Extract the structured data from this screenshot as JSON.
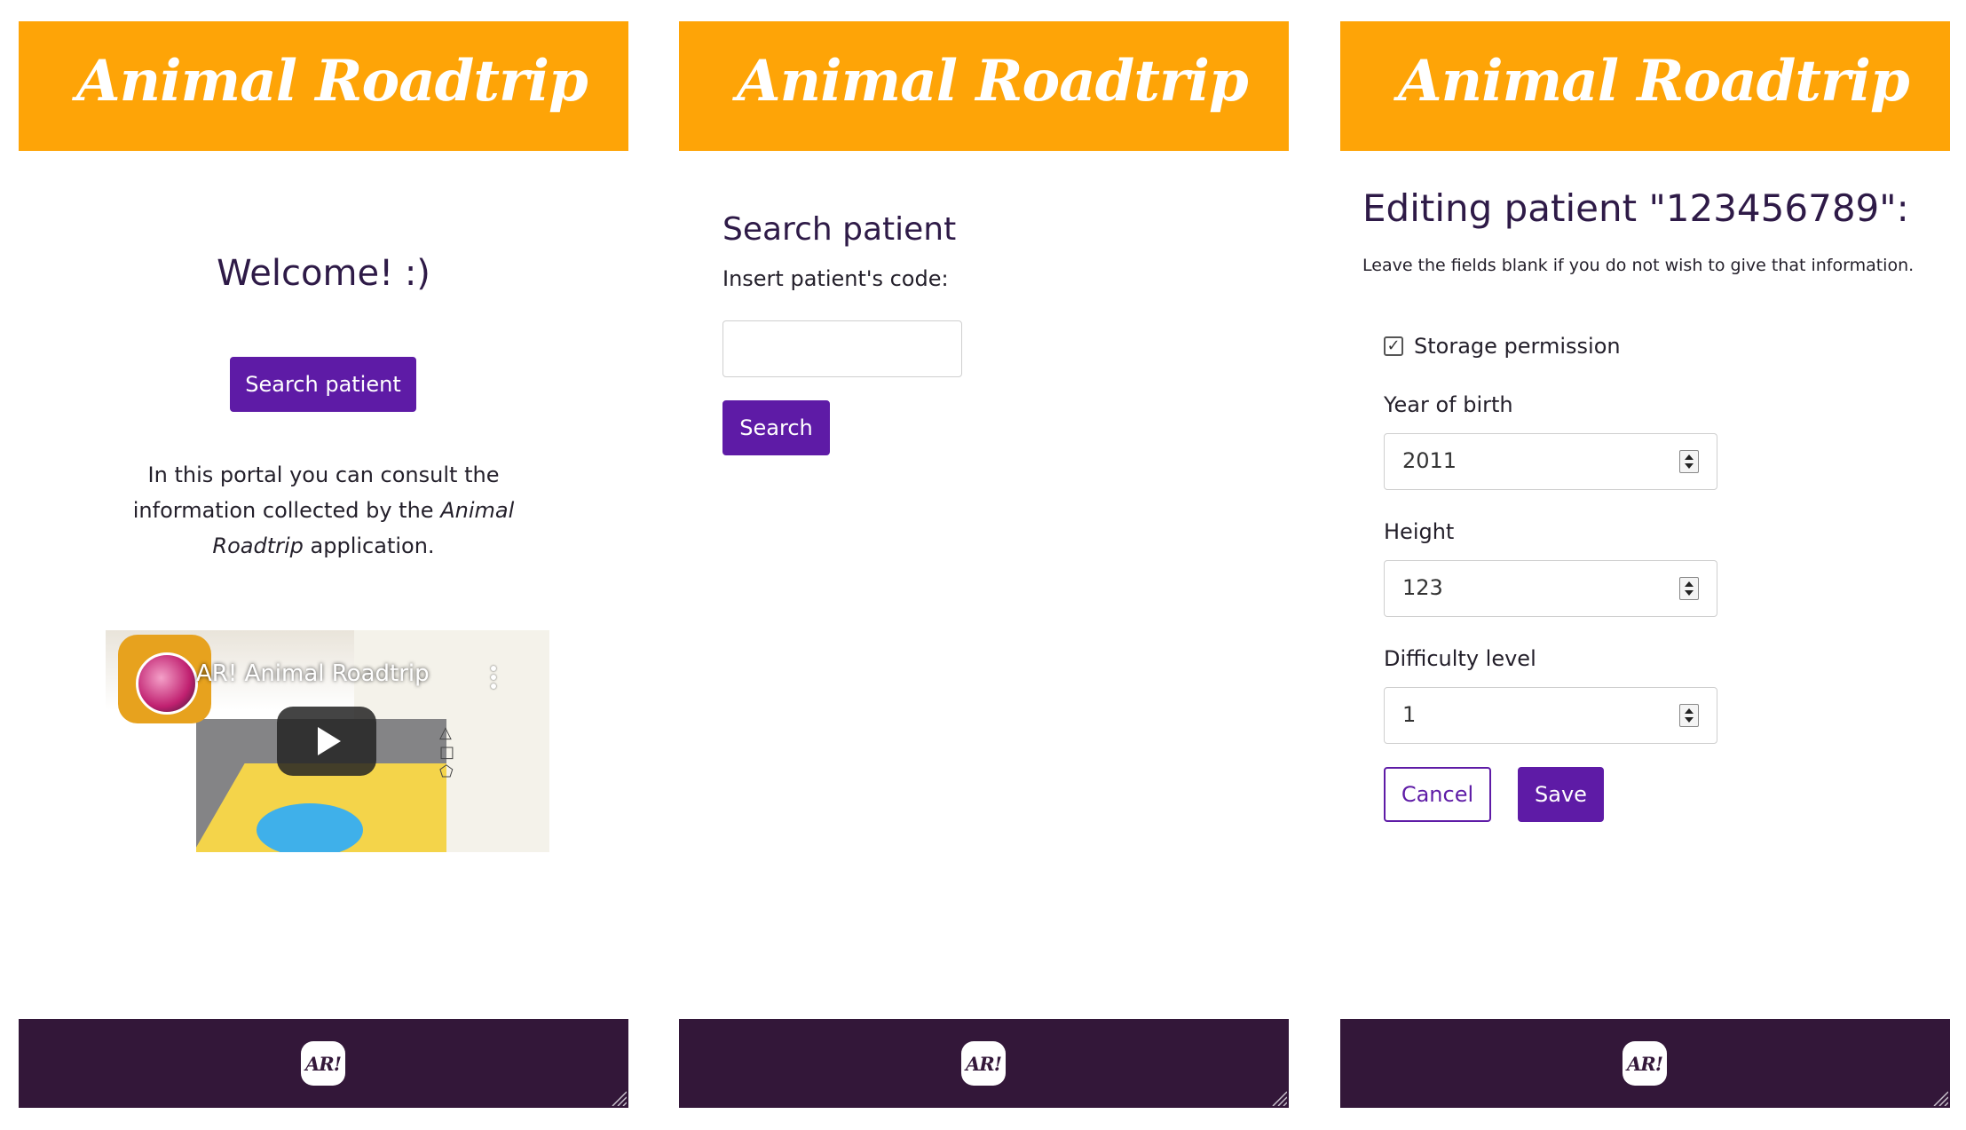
{
  "app": {
    "brand": "Animal Roadtrip",
    "footer_logo": "AR!",
    "colors": {
      "header": "#fea407",
      "footer": "#331739",
      "accent": "#5e1ba6"
    }
  },
  "home": {
    "welcome": "Welcome! :)",
    "search_button": "Search patient",
    "intro_before": "In this portal you can consult the information collected by the ",
    "intro_app_name": "Animal Roadtrip",
    "intro_after": " application.",
    "video": {
      "title": "AR! Animal Roadtrip",
      "channel_logo_text": "Animal Roadtrip"
    }
  },
  "search": {
    "title": "Search patient",
    "code_label": "Insert patient's code:",
    "code_value": "",
    "search_button": "Search"
  },
  "edit": {
    "title": "Editing patient \"123456789\":",
    "note": "Leave the fields blank if you do not wish to give that information.",
    "storage_permission": {
      "label": "Storage permission",
      "checked": true
    },
    "fields": [
      {
        "label": "Year of birth",
        "value": "2011"
      },
      {
        "label": "Height",
        "value": "123"
      },
      {
        "label": "Difficulty level",
        "value": "1"
      }
    ],
    "cancel_button": "Cancel",
    "save_button": "Save"
  }
}
